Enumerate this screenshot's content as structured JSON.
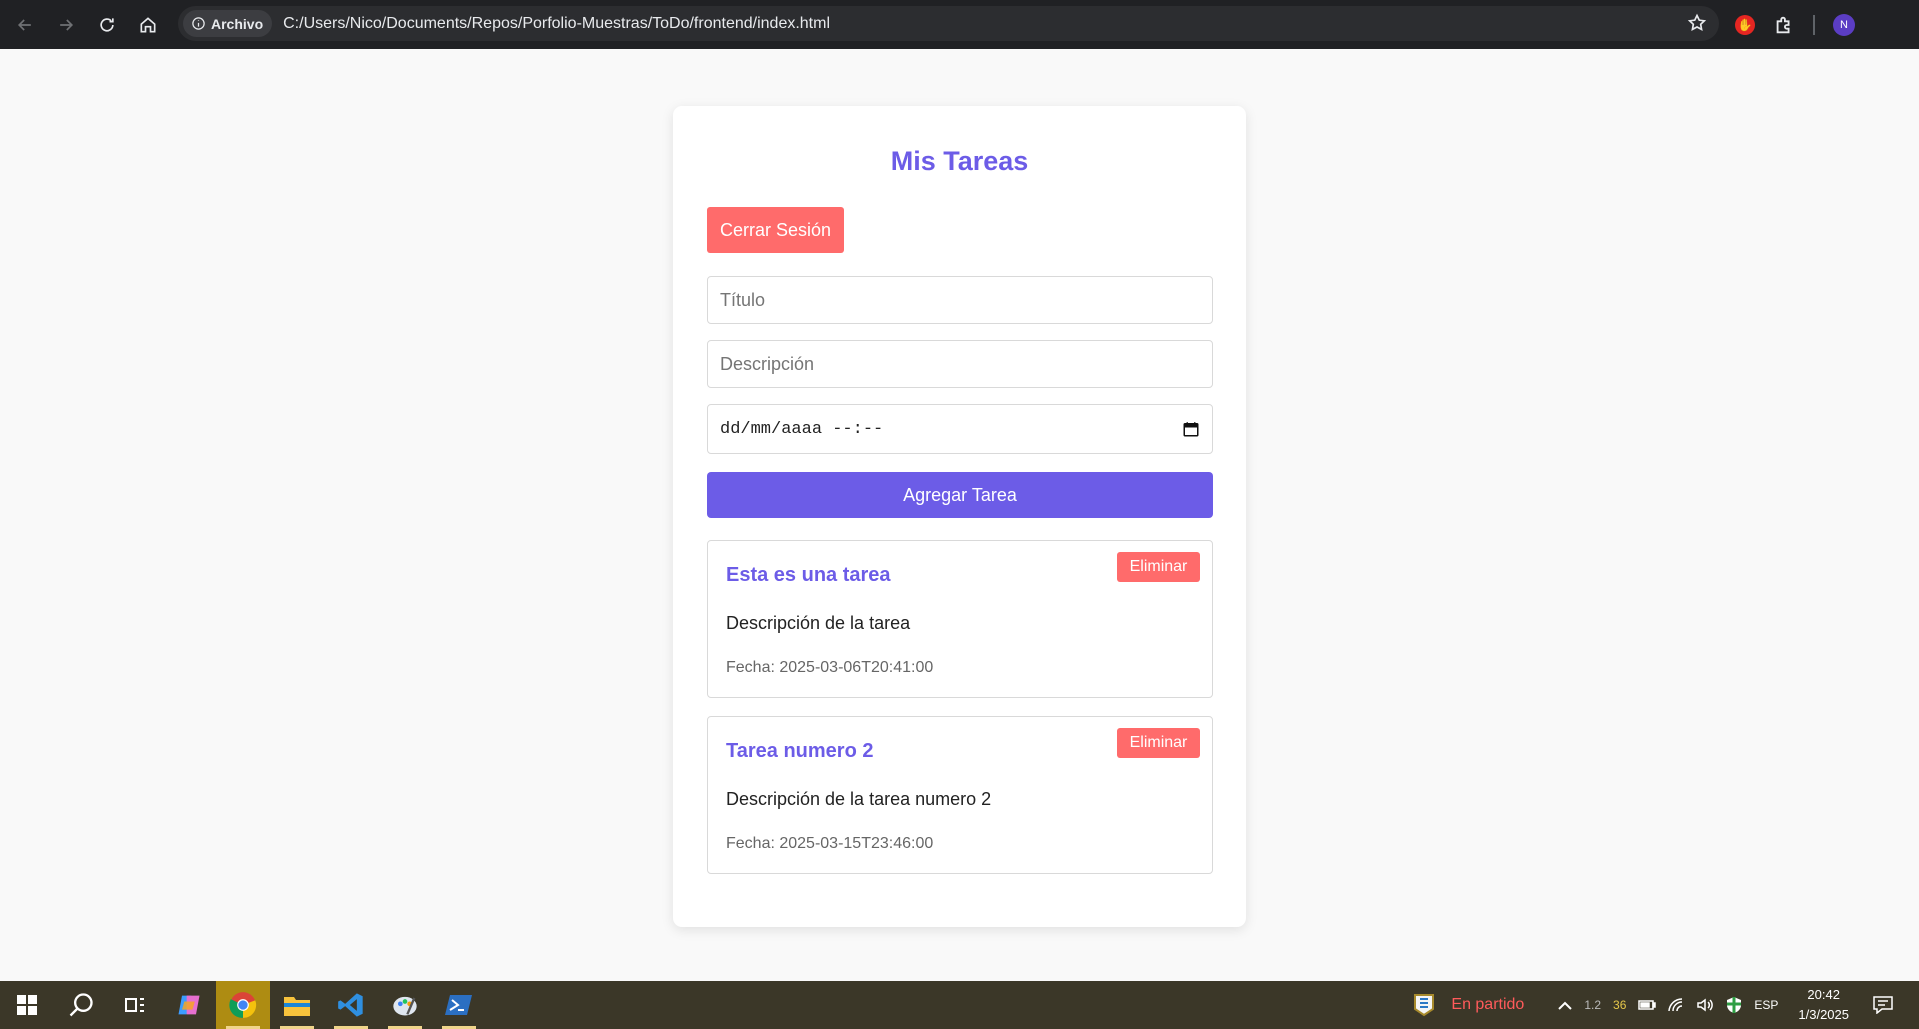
{
  "browser": {
    "site_chip": "Archivo",
    "url": "C:/Users/Nico/Documents/Repos/Porfolio-Muestras/ToDo/frontend/index.html",
    "profile_initial": "N"
  },
  "app": {
    "title": "Mis Tareas",
    "logout_label": "Cerrar Sesión",
    "title_placeholder": "Título",
    "description_placeholder": "Descripción",
    "datetime_value": "dd/mm/aaaa --:--",
    "add_label": "Agregar Tarea",
    "tasks": [
      {
        "title": "Esta es una tarea",
        "description": "Descripción de la tarea",
        "date": "Fecha: 2025-03-06T20:41:00",
        "delete_label": "Eliminar"
      },
      {
        "title": "Tarea numero 2",
        "description": "Descripción de la tarea numero 2",
        "date": "Fecha: 2025-03-15T23:46:00",
        "delete_label": "Eliminar"
      }
    ]
  },
  "taskbar": {
    "weather_text": "En partido",
    "tray_num1": "1.2",
    "tray_num2": "36",
    "language": "ESP",
    "time": "20:42",
    "date": "1/3/2025"
  },
  "colors": {
    "accent": "#6c5ce7",
    "danger": "#ff6b6b",
    "taskbar": "#3b3728"
  }
}
